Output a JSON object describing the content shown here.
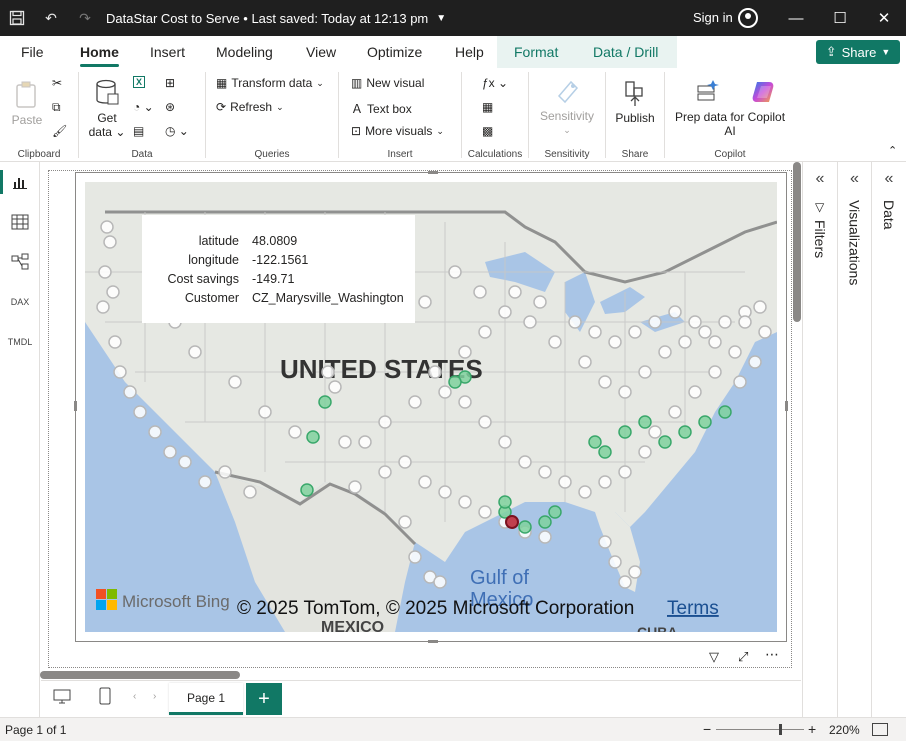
{
  "titlebar": {
    "title": "DataStar Cost to Serve • Last saved: Today at 12:13 pm",
    "sign_in": "Sign in"
  },
  "menu": {
    "tabs": [
      "File",
      "Home",
      "Insert",
      "Modeling",
      "View",
      "Optimize",
      "Help",
      "Format",
      "Data / Drill"
    ],
    "share_label": "Share"
  },
  "ribbon": {
    "clipboard": {
      "paste": "Paste",
      "label": "Clipboard"
    },
    "data": {
      "get_data_1": "Get",
      "get_data_2": "data",
      "label": "Data"
    },
    "queries": {
      "transform": "Transform data",
      "refresh": "Refresh",
      "label": "Queries"
    },
    "insert": {
      "new_visual": "New visual",
      "text_box": "Text box",
      "more_visuals": "More visuals",
      "label": "Insert"
    },
    "calculations": {
      "label": "Calculations"
    },
    "sensitivity": {
      "button": "Sensitivity",
      "label": "Sensitivity"
    },
    "share": {
      "publish": "Publish",
      "label": "Share"
    },
    "copilot": {
      "prep_1": "Prep data for Copilot",
      "prep_2": "AI",
      "label": "Copilot"
    }
  },
  "panes": {
    "filters": "Filters",
    "visualizations": "Visualizations",
    "data": "Data"
  },
  "map": {
    "country_label": "UNITED STATES",
    "gulf_label_1": "Gulf of",
    "gulf_label_2": "Mexico",
    "mexico_label": "MEXICO",
    "cuba_label": "CUBA",
    "bing": "Microsoft Bing",
    "copyright": "© 2025 TomTom, © 2025 Microsoft Corporation",
    "terms": "Terms"
  },
  "tooltip": {
    "rows": [
      {
        "k": "latitude",
        "v": "48.0809"
      },
      {
        "k": "longitude",
        "v": "-122.1561"
      },
      {
        "k": "Cost savings",
        "v": "-149.71"
      },
      {
        "k": "Customer",
        "v": "CZ_Marysville_Washington"
      }
    ]
  },
  "pages": {
    "current": "Page 1"
  },
  "status": {
    "page_info": "Page 1 of 1",
    "zoom": "220%",
    "zoom_level": 0.72
  },
  "colors": {
    "accent": "#117865",
    "positive": "#3aa86b",
    "negative": "#c0404f",
    "neutral": "#ffffff"
  }
}
